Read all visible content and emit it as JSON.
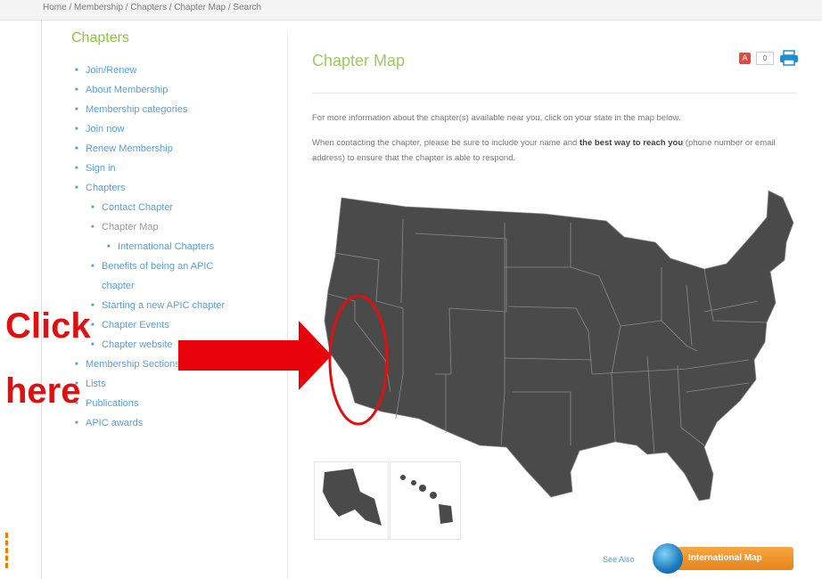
{
  "header": {
    "breadcrumb": "Home / Membership / Chapters / Chapter Map / Search"
  },
  "sidebar": {
    "title": "Chapters",
    "items": [
      {
        "label": "Join/Renew"
      },
      {
        "label": "About Membership"
      },
      {
        "label": "Membership categories"
      },
      {
        "label": "Join now"
      },
      {
        "label": "Renew Membership"
      },
      {
        "label": "Sign in"
      },
      {
        "label": "Chapters"
      },
      {
        "label": "Contact Chapter"
      },
      {
        "label": "Chapter Map"
      },
      {
        "label": "International Chapters"
      },
      {
        "label": "Benefits of being an APIC"
      },
      {
        "label": "chapter"
      },
      {
        "label": "Starting a new APIC chapter"
      },
      {
        "label": "Chapter Events"
      },
      {
        "label": "Chapter website"
      },
      {
        "label": "Membership Sections"
      },
      {
        "label": "Lists"
      },
      {
        "label": "Publications"
      },
      {
        "label": "APIC awards"
      }
    ]
  },
  "main": {
    "title": "Chapter Map",
    "tools": {
      "pdf_label": "A",
      "count_label": "0"
    },
    "para1": "For more information about the chapter(s) available near you, click on your state in the map below.",
    "para2_start": "When contacting the chapter, please be sure to include your name and ",
    "para2_bold": "the best way to reach you",
    "para2_end": " (phone number or email address) to ensure that the chapter is able to respond.",
    "see_also": "See Also",
    "intl_button": "International Map"
  },
  "annotation": {
    "click_line1": "Click",
    "click_line2": "here",
    "color": "#e01010"
  },
  "colors": {
    "map_fill": "#4a4a4a",
    "state_border": "#8a8a8a",
    "accent_green": "#8cc63f",
    "link_blue": "#5a9fd6",
    "button_orange": "#e8841a"
  }
}
